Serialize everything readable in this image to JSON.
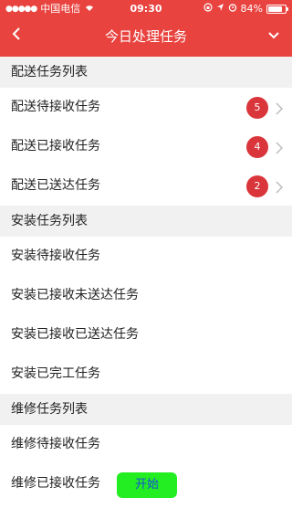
{
  "status_bar": {
    "carrier": "中国电信",
    "time": "09:30",
    "battery": "84%",
    "battery_level": 0.84
  },
  "navbar": {
    "title": "今日处理任务",
    "back_icon": "back-chevron-icon",
    "menu_icon": "chevron-down-icon"
  },
  "sections": {
    "delivery": {
      "title": "配送任务列表",
      "items": [
        {
          "label": "配送待接收任务",
          "badge": "5"
        },
        {
          "label": "配送已接收任务",
          "badge": "4"
        },
        {
          "label": "配送已送达任务",
          "badge": "2"
        }
      ]
    },
    "install": {
      "title": "安装任务列表",
      "items": [
        {
          "label": "安装待接收任务"
        },
        {
          "label": "安装已接收未送达任务"
        },
        {
          "label": "安装已接收已送达任务"
        },
        {
          "label": "安装已完工任务"
        }
      ]
    },
    "repair": {
      "title": "维修任务列表",
      "items": [
        {
          "label": "维修待接收任务"
        },
        {
          "label": "维修已接收任务",
          "button": "开始"
        }
      ]
    }
  },
  "colors": {
    "header": "#e8433f",
    "badge": "#d9353a",
    "start_button": "#22ee22",
    "start_button_text": "#1b4fd8"
  }
}
